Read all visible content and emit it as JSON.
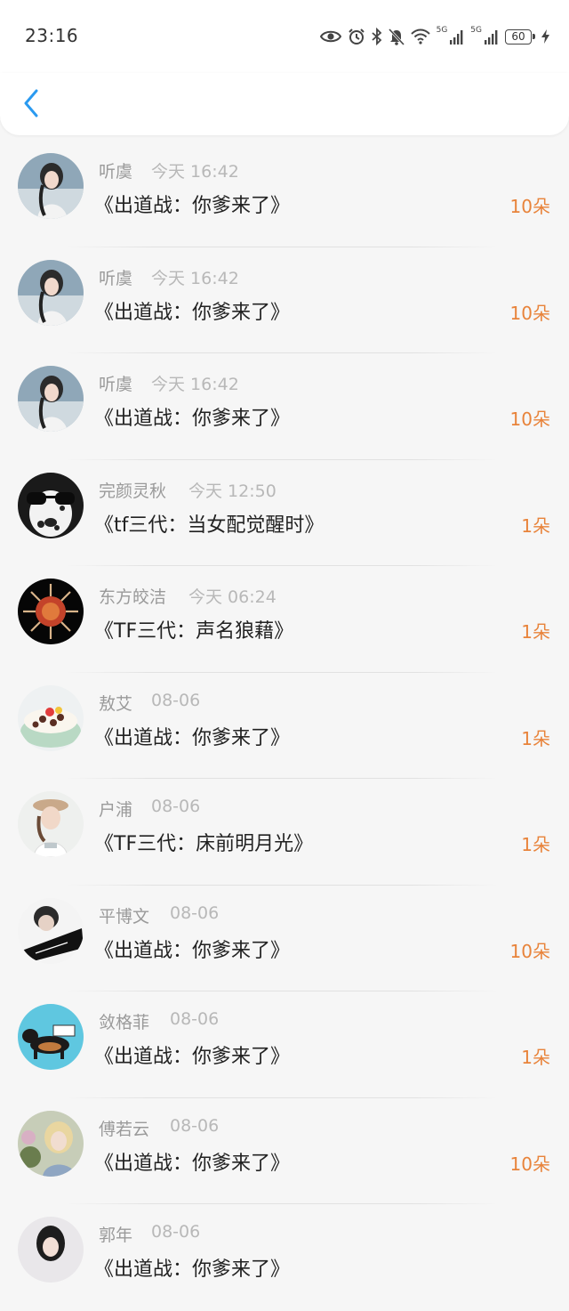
{
  "status_bar": {
    "time": "23:16",
    "signal_1_label": "5G",
    "signal_2_label": "5G",
    "battery": "60"
  },
  "header": {
    "back_icon": "chevron-left-icon",
    "accent_color": "#2a9af0"
  },
  "colors": {
    "amount": "#e8833a",
    "name": "#9a9a9a",
    "time": "#b8b8b8",
    "title": "#222222"
  },
  "rows": [
    {
      "name": "听虞",
      "time": "今天 16:42",
      "title": "《出道战：你爹来了》",
      "amount": "10朵"
    },
    {
      "name": "听虞",
      "time": "今天 16:42",
      "title": "《出道战：你爹来了》",
      "amount": "10朵"
    },
    {
      "name": "听虞",
      "time": "今天 16:42",
      "title": "《出道战：你爹来了》",
      "amount": "10朵"
    },
    {
      "name": "完颜灵秋",
      "time": "今天 12:50",
      "title": "《tf三代：当女配觉醒时》",
      "amount": "1朵"
    },
    {
      "name": "东方皎洁",
      "time": "今天 06:24",
      "title": "《TF三代：声名狼藉》",
      "amount": "1朵"
    },
    {
      "name": "敖艾",
      "time": "08-06",
      "title": "《出道战：你爹来了》",
      "amount": "1朵"
    },
    {
      "name": "户浦",
      "time": "08-06",
      "title": "《TF三代：床前明月光》",
      "amount": "1朵"
    },
    {
      "name": "平博文",
      "time": "08-06",
      "title": "《出道战：你爹来了》",
      "amount": "10朵"
    },
    {
      "name": "敛格菲",
      "time": "08-06",
      "title": "《出道战：你爹来了》",
      "amount": "1朵"
    },
    {
      "name": "傅若云",
      "time": "08-06",
      "title": "《出道战：你爹来了》",
      "amount": "10朵"
    },
    {
      "name": "郭年",
      "time": "08-06",
      "title": "《出道战：你爹来了》",
      "amount": ""
    }
  ]
}
